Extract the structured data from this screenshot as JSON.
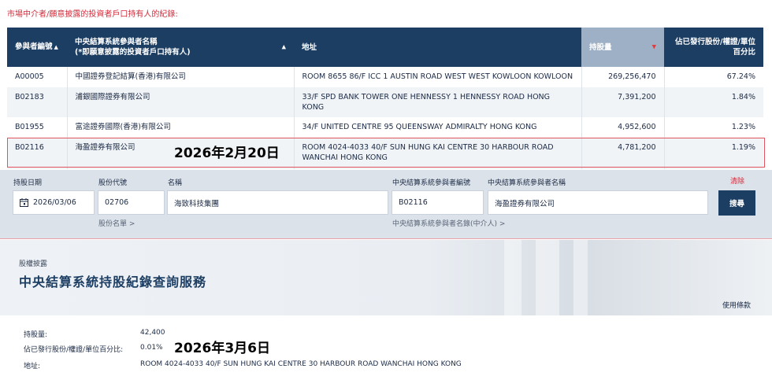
{
  "intro": "市場中介者/願意披露的投資者戶口持有人的紀錄:",
  "table": {
    "headers": {
      "id": "參與者編號",
      "name_line1": "中央結算系統參與者名稱",
      "name_line2": "(*即願意披露的投資者戶口持有人)",
      "address": "地址",
      "shareholding": "持股量",
      "percent": "佔已發行股份/權證/單位百分比"
    },
    "rows": [
      {
        "id": "A00005",
        "name": "中國證券登記結算(香港)有限公司",
        "address": "ROOM 8655 86/F ICC 1 AUSTIN ROAD WEST WEST KOWLOON KOWLOON",
        "shareholding": "269,256,470",
        "percent": "67.24%"
      },
      {
        "id": "B02183",
        "name": "浦銀國際證券有限公司",
        "address": "33/F SPD BANK TOWER ONE HENNESSY 1 HENNESSY ROAD HONG KONG",
        "shareholding": "7,391,200",
        "percent": "1.84%"
      },
      {
        "id": "B01955",
        "name": "富途證券國際(香港)有限公司",
        "address": "34/F UNITED CENTRE 95 QUEENSWAY ADMIRALTY HONG KONG",
        "shareholding": "4,952,600",
        "percent": "1.23%"
      },
      {
        "id": "B02116",
        "name": "海盈證券有限公司",
        "address": "ROOM 4024-4033 40/F SUN HUNG KAI CENTRE 30 HARBOUR ROAD WANCHAI HONG KONG",
        "shareholding": "4,781,200",
        "percent": "1.19%"
      }
    ]
  },
  "annotations": {
    "date1": "2026年2月20日",
    "date2": "2026年3月6日"
  },
  "search": {
    "labels": {
      "date": "持股日期",
      "code": "股份代號",
      "name": "名稱",
      "participant_id": "中央結算系統參與者編號",
      "participant_name": "中央結算系統參與者名稱"
    },
    "values": {
      "date": "2026/03/06",
      "code": "02706",
      "name": "海致科技集團",
      "participant_id": "B02116",
      "participant_name": "海盈證券有限公司"
    },
    "links": {
      "stock_list": "股份名單 >",
      "participant_list": "中央結算系統參與者名錄(中介人) >"
    },
    "clear": "清除",
    "button": "搜尋"
  },
  "banner": {
    "subtitle": "股權披露",
    "title": "中央結算系統持股紀錄查詢服務",
    "terms": "使用條款"
  },
  "detail": {
    "shareholding_label": "持股量:",
    "shareholding_value": "42,400",
    "percent_label": "佔已發行股份/權證/單位百分比:",
    "percent_value": "0.01%",
    "address_label": "地址:",
    "address_value": "ROOM 4024-4033 40/F SUN HUNG KAI CENTRE 30 HARBOUR ROAD WANCHAI HONG KONG"
  },
  "colors": {
    "header_bg": "#1d3e63",
    "sorted_header_bg": "#9db0c6",
    "accent_red": "#d12b3a",
    "panel_bg": "#dbe2e9"
  },
  "icons": {
    "sort_asc": "sort-up-icon",
    "sort_desc": "sort-down-icon",
    "calendar": "calendar-icon"
  }
}
